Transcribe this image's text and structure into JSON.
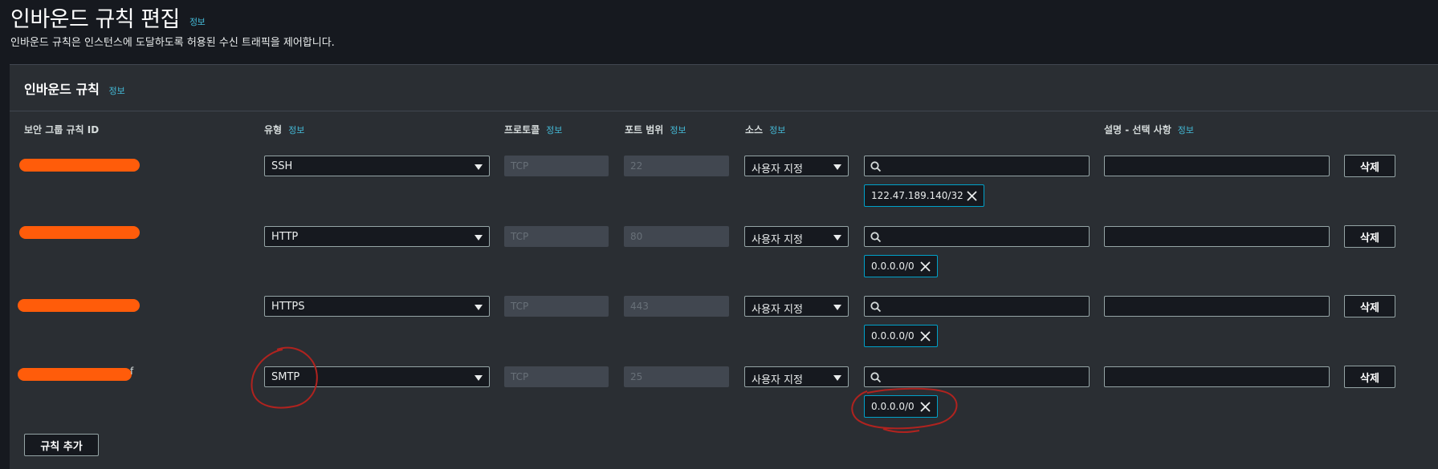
{
  "header": {
    "title": "인바운드 규칙 편집",
    "info": "정보",
    "description": "인바운드 규칙은 인스턴스에 도달하도록 허용된 수신 트래픽을 제어합니다."
  },
  "panel": {
    "title": "인바운드 규칙",
    "info": "정보"
  },
  "columns": {
    "rule_id": "보안 그룹 규칙 ID",
    "type": "유형",
    "protocol": "프로토콜",
    "port_range": "포트 범위",
    "source": "소스",
    "description": "설명 - 선택 사항",
    "info": "정보"
  },
  "rules": [
    {
      "id_visible": "",
      "type": "SSH",
      "protocol": "TCP",
      "port": "22",
      "source_mode": "사용자 지정",
      "cidr": "122.47.189.140/32",
      "delete_label": "삭제"
    },
    {
      "id_visible": "",
      "type": "HTTP",
      "protocol": "TCP",
      "port": "80",
      "source_mode": "사용자 지정",
      "cidr": "0.0.0.0/0",
      "delete_label": "삭제"
    },
    {
      "id_visible": "",
      "type": "HTTPS",
      "protocol": "TCP",
      "port": "443",
      "source_mode": "사용자 지정",
      "cidr": "0.0.0.0/0",
      "delete_label": "삭제"
    },
    {
      "id_visible": "f",
      "type": "SMTP",
      "protocol": "TCP",
      "port": "25",
      "source_mode": "사용자 지정",
      "cidr": "0.0.0.0/0",
      "delete_label": "삭제"
    }
  ],
  "add_rule_label": "규칙 추가",
  "colors": {
    "background": "#16191f",
    "panel": "#2a2e33",
    "info_link": "#44b9d6",
    "token_border": "#00a1c9",
    "redaction": "#ff5c0a",
    "annotation": "#b0231f"
  }
}
